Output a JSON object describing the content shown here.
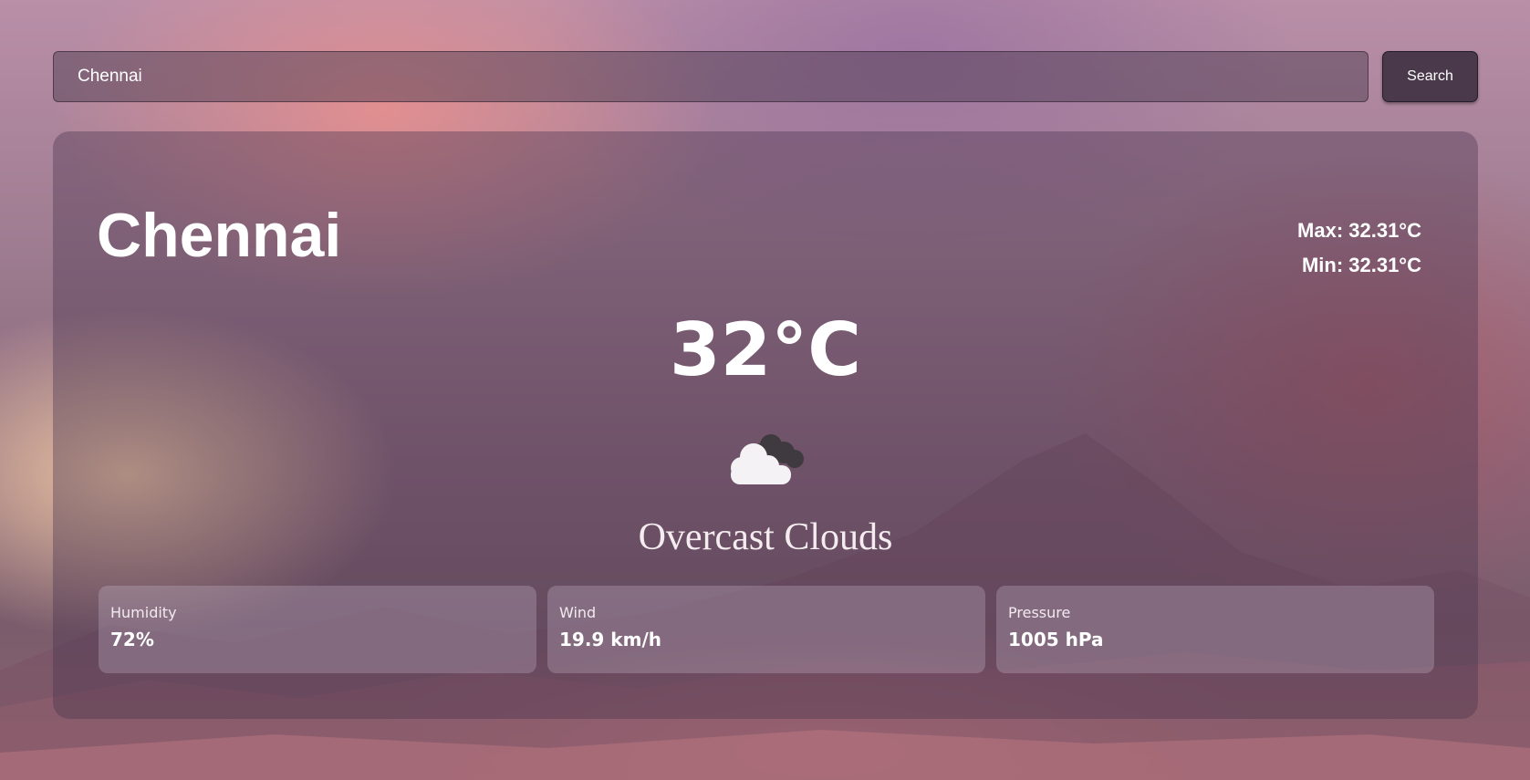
{
  "search": {
    "value": "Chennai",
    "button_label": "Search"
  },
  "weather": {
    "city": "Chennai",
    "max": "Max: 32.31°C",
    "min": "Min: 32.31°C",
    "temperature": "32°C",
    "icon": "overcast-clouds-icon",
    "description": "Overcast Clouds"
  },
  "stats": [
    {
      "label": "Humidity",
      "value": "72%"
    },
    {
      "label": "Wind",
      "value": "19.9 km/h"
    },
    {
      "label": "Pressure",
      "value": "1005 hPa"
    }
  ]
}
